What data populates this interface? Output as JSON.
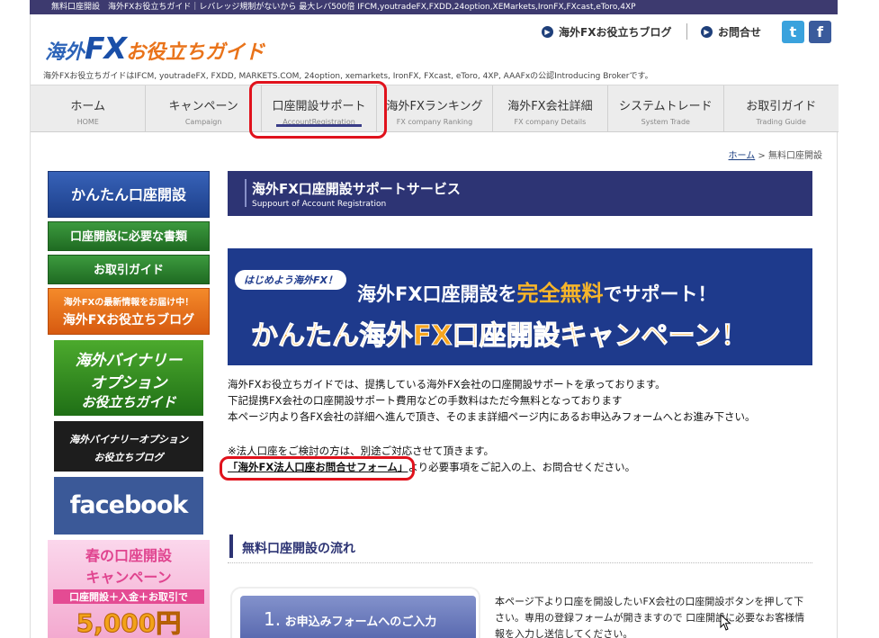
{
  "topbar": {
    "text": "無料口座開設　海外FXお役立ちガイド｜レバレッジ規制がないから 最大レバ500倍 IFCM,youtradeFX,FXDD,24option,XEMarkets,IronFX,FXcast,eToro,4XP"
  },
  "header": {
    "logo_part1": "海外",
    "logo_part2": "FX",
    "logo_part3": "お役立ちガイド",
    "tagline": "海外FXお役立ちガイドはIFCM, youtradeFX, FXDD, MARKETS.COM, 24option, xemarkets, IronFX, FXcast, eToro, 4XP, AAAFxの公認Introducing Brokerです。",
    "links": [
      "海外FXお役立ちブログ",
      "お問合せ"
    ],
    "social": {
      "twitter": "t",
      "facebook": "f"
    }
  },
  "nav": [
    {
      "jp": "ホーム",
      "en": "HOME"
    },
    {
      "jp": "キャンペーン",
      "en": "Campaign"
    },
    {
      "jp": "口座開設サポート",
      "en": "AccountRegistration"
    },
    {
      "jp": "海外FXランキング",
      "en": "FX company Ranking"
    },
    {
      "jp": "海外FX会社詳細",
      "en": "FX company Details"
    },
    {
      "jp": "システムトレード",
      "en": "System Trade"
    },
    {
      "jp": "お取引ガイド",
      "en": "Trading Guide"
    }
  ],
  "breadcrumb": {
    "home": "ホーム",
    "sep": " > ",
    "current": "無料口座開設"
  },
  "sidebar": {
    "main_button": "かんたん口座開設",
    "documents_button": "口座開設に必要な書類",
    "guide_button": "お取引ガイド",
    "blog_small": "海外FXの最新情報をお届け中！",
    "blog_big": "海外FXお役立ちブログ",
    "binary_line1": "海外バイナリー",
    "binary_line2": "オプション",
    "binary_line3": "お役立ちガイド",
    "binary_blog_line1": "海外バイナリーオプション",
    "binary_blog_line2": "お役立ちブログ",
    "facebook": "facebook",
    "spring_line1": "春の口座開設",
    "spring_line2": "キャンペーン",
    "spring_line3": "口座開設＋入金＋お取引で",
    "spring_line4": "5,000円"
  },
  "main": {
    "title_jp": "海外FX口座開設サポートサービス",
    "title_en": "Suppourt of Account Registration",
    "banner_tag": "はじめよう海外FX！",
    "banner_l1a": "海外FX口座開設を",
    "banner_l1b": "完全無料",
    "banner_l1c": "でサポート！",
    "banner_l2": "かんたん海外FX口座開設キャンペーン！",
    "para1": "海外FXお役立ちガイドでは、提携している海外FX会社の口座開設サポートを承っております。",
    "para2": "下記提携FX会社の口座開設サポート費用などの手数料はただ今無料となっております",
    "para3": "本ページ内より各FX会社の詳細へ進んで頂き、そのまま詳細ページ内にあるお申込みフォームへとお進み下さい。",
    "corp_note": "※法人口座をご検討の方は、別途ご対応させて頂きます。",
    "corp_form_link": "「海外FX法人口座お問合せフォーム」",
    "corp_form_after": "より必要事項をご記入の上、お問合せください。",
    "section_title": "無料口座開設の流れ",
    "step_num": "1.",
    "step_label": "お申込みフォームへのご入力",
    "step_desc": "本ページ下より口座を開設したいFX会社の口座開設ボタンを押して下さい。専用の登録フォームが開きますので 口座開設に必要なお客様情報を入力し送信してください。"
  }
}
